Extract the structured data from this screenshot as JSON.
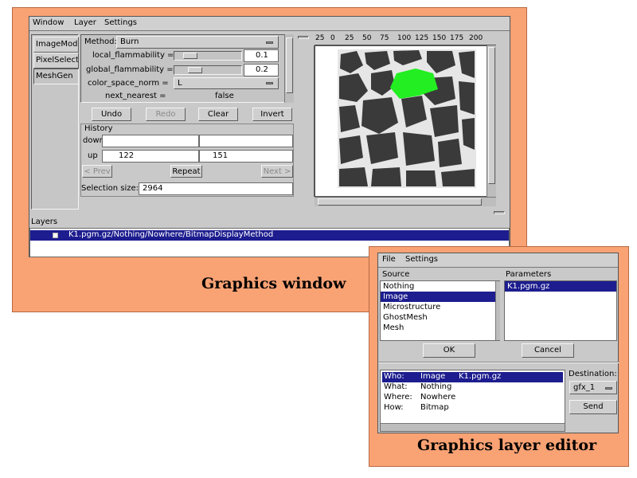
{
  "graphics_window": {
    "menu": [
      "Window",
      "Layer",
      "Settings"
    ],
    "toolboxes": [
      "ImageMod",
      "PixelSelect",
      "MeshGen"
    ],
    "method_label": "Method:",
    "method_value": "Burn",
    "params": [
      {
        "label": "local_flammability =",
        "value": "0.1",
        "slider_fraction": 0.1
      },
      {
        "label": "global_flammability =",
        "value": "0.2",
        "slider_fraction": 0.2
      }
    ],
    "color_space_label": "color_space_norm =",
    "color_space_value": "L",
    "next_nearest_label": "next_nearest =",
    "next_nearest_value": "false",
    "buttons": {
      "undo": "Undo",
      "redo": "Redo",
      "clear": "Clear",
      "invert": "Invert"
    },
    "history": {
      "title": "History",
      "rows": [
        {
          "label": "down",
          "x": "",
          "y": ""
        },
        {
          "label": "up",
          "x": "122",
          "y": "151"
        }
      ],
      "prev": "< Prev",
      "repeat": "Repeat",
      "next": "Next >"
    },
    "selection_size_label": "Selection size:",
    "selection_size_value": "2964",
    "ruler_ticks": [
      "25",
      "0",
      "25",
      "50",
      "75",
      "100",
      "125",
      "150",
      "175",
      "200"
    ],
    "layers_title": "Layers",
    "layers": [
      "K1.pgm.gz/Nothing/Nowhere/BitmapDisplayMethod"
    ],
    "caption": "Graphics window",
    "selection_color": "#22ee22"
  },
  "layer_editor": {
    "menu": [
      "File",
      "Settings"
    ],
    "source_title": "Source",
    "sources": [
      "Nothing",
      "Image",
      "Microstructure",
      "GhostMesh",
      "Mesh"
    ],
    "selected_source": "Image",
    "parameters_title": "Parameters",
    "parameters": [
      "K1.pgm.gz"
    ],
    "ok": "OK",
    "cancel": "Cancel",
    "summary": [
      {
        "key": "Who:",
        "value": "Image",
        "extra": "K1.pgm.gz"
      },
      {
        "key": "What:",
        "value": "Nothing",
        "extra": ""
      },
      {
        "key": "Where:",
        "value": "Nowhere",
        "extra": ""
      },
      {
        "key": "How:",
        "value": "Bitmap",
        "extra": ""
      }
    ],
    "destination_label": "Destination:",
    "destination_value": "gfx_1",
    "send": "Send",
    "caption": "Graphics layer editor"
  }
}
